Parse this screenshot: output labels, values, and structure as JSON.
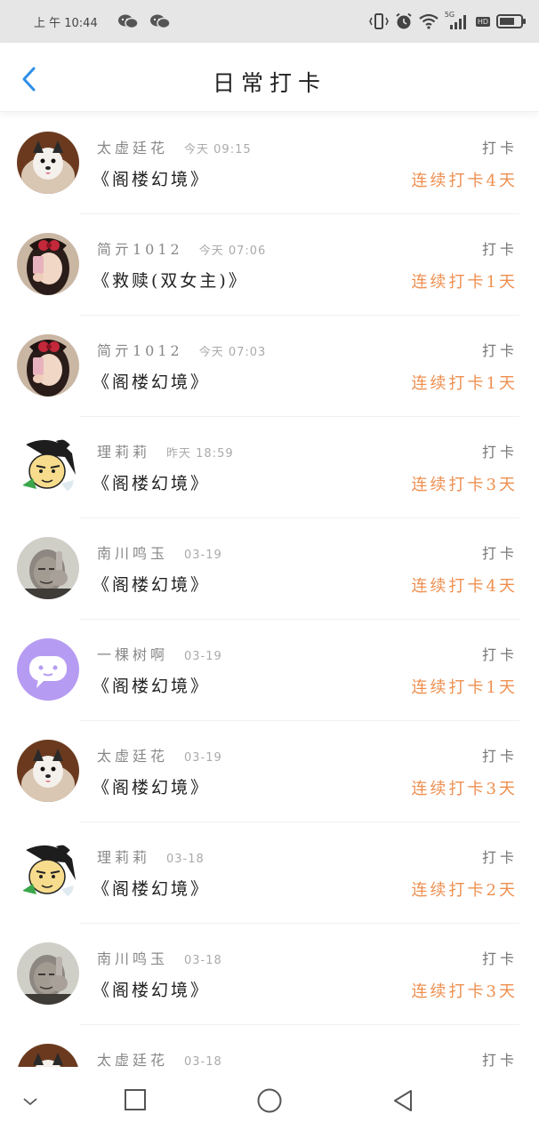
{
  "status_bar": {
    "time": "上 午 10:44",
    "network": "5G",
    "hd": "HD"
  },
  "header": {
    "title": "日常打卡",
    "back_icon": "chevron-left-icon"
  },
  "colors": {
    "streak": "#ee8f4f",
    "back_arrow": "#2d8fe8",
    "status_bg": "#e6e6e6"
  },
  "entries": [
    {
      "name": "太虚廷花",
      "time": "今天 09:15",
      "book": "《阁楼幻境》",
      "action": "打卡",
      "streak": "连续打卡4天",
      "avatar": "dog"
    },
    {
      "name": "简亓1012",
      "time": "今天 07:06",
      "book": "《救赎(双女主)》",
      "action": "打卡",
      "streak": "连续打卡1天",
      "avatar": "girl"
    },
    {
      "name": "简亓1012",
      "time": "今天 07:03",
      "book": "《阁楼幻境》",
      "action": "打卡",
      "streak": "连续打卡1天",
      "avatar": "girl"
    },
    {
      "name": "理莉莉",
      "time": "昨天 18:59",
      "book": "《阁楼幻境》",
      "action": "打卡",
      "streak": "连续打卡3天",
      "avatar": "cartoon"
    },
    {
      "name": "南川鸣玉",
      "time": "03-19",
      "book": "《阁楼幻境》",
      "action": "打卡",
      "streak": "连续打卡4天",
      "avatar": "man"
    },
    {
      "name": "一棵树啊",
      "time": "03-19",
      "book": "《阁楼幻境》",
      "action": "打卡",
      "streak": "连续打卡1天",
      "avatar": "chat"
    },
    {
      "name": "太虚廷花",
      "time": "03-19",
      "book": "《阁楼幻境》",
      "action": "打卡",
      "streak": "连续打卡3天",
      "avatar": "dog"
    },
    {
      "name": "理莉莉",
      "time": "03-18",
      "book": "《阁楼幻境》",
      "action": "打卡",
      "streak": "连续打卡2天",
      "avatar": "cartoon"
    },
    {
      "name": "南川鸣玉",
      "time": "03-18",
      "book": "《阁楼幻境》",
      "action": "打卡",
      "streak": "连续打卡3天",
      "avatar": "man"
    },
    {
      "name": "太虚廷花",
      "time": "03-18",
      "book": "",
      "action": "打卡",
      "streak": "",
      "avatar": "dog"
    }
  ],
  "nav_bar": {
    "icons": [
      "chevron-down-icon",
      "recents-square-icon",
      "home-circle-icon",
      "back-triangle-icon"
    ]
  }
}
